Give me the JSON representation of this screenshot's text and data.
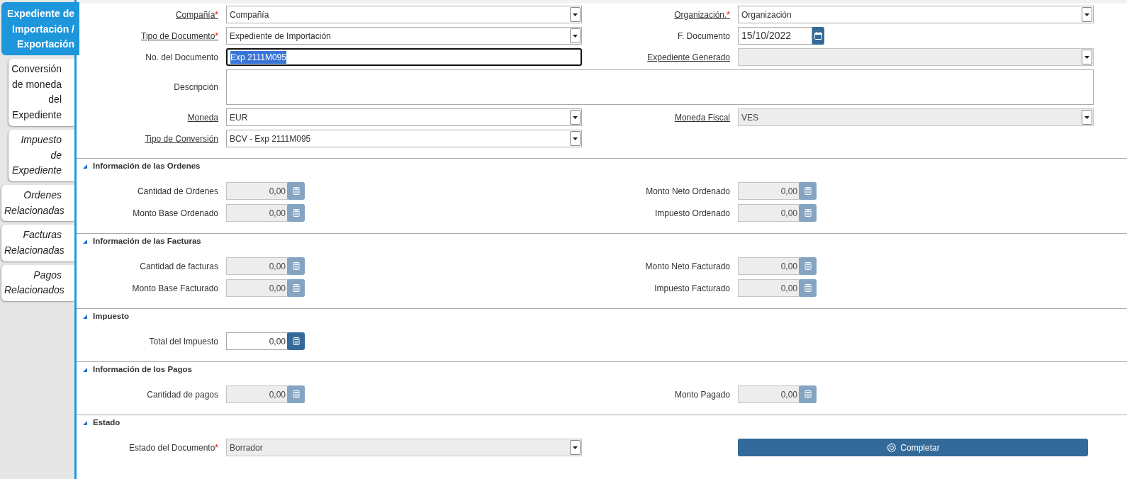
{
  "sidebar": {
    "tabs": [
      {
        "label": "Expediente de Importación / Exportación",
        "selected": true,
        "italic": false,
        "children": [
          {
            "label": "Conversión de moneda del Expediente",
            "selected": false,
            "italic": false
          },
          {
            "label": "Impuesto de Expediente",
            "selected": false,
            "italic": true
          }
        ]
      },
      {
        "label": "Ordenes Relacionadas",
        "selected": false,
        "italic": true
      },
      {
        "label": "Facturas Relacionadas",
        "selected": false,
        "italic": true
      },
      {
        "label": "Pagos Relacionados",
        "selected": false,
        "italic": true
      }
    ]
  },
  "header": {
    "rows": [
      [
        {
          "kind": "select",
          "label": "Compañía",
          "required_mark": "*",
          "link": true,
          "read_only": false,
          "value": "Compañía"
        },
        {
          "kind": "select",
          "label": "Organización.",
          "required_mark": "*",
          "link": true,
          "read_only": false,
          "value": "Organización"
        }
      ],
      [
        {
          "kind": "select",
          "label": "Tipo de Documento",
          "required_mark": "*",
          "link": true,
          "read_only": false,
          "value": "Expediente de Importación"
        },
        {
          "kind": "date",
          "label": "F. Documento",
          "link": false,
          "read_only": false,
          "value": "15/10/2022"
        }
      ],
      [
        {
          "kind": "text",
          "label": "No. del Documento",
          "link": false,
          "read_only": false,
          "focused": true,
          "value": "Exp 2111M095"
        },
        {
          "kind": "select",
          "label": "Expediente Generado",
          "link": true,
          "read_only": true
        }
      ],
      [
        {
          "kind": "textarea",
          "label": "Descripción",
          "link": false,
          "read_only": false
        }
      ],
      [
        {
          "kind": "select",
          "label": "Moneda",
          "link": true,
          "read_only": false,
          "value": "EUR"
        },
        {
          "kind": "select",
          "label": "Moneda Fiscal",
          "link": true,
          "read_only": true,
          "value": "VES"
        }
      ],
      [
        {
          "kind": "select",
          "label": "Tipo de Conversión",
          "link": true,
          "read_only": false,
          "value": "BCV - Exp 2111M095"
        }
      ]
    ]
  },
  "sections": [
    {
      "title": "Información de las Ordenes",
      "expanded": true,
      "rows": [
        [
          {
            "kind": "number",
            "label": "Cantidad de Ordenes",
            "read_only": true,
            "value": "0,00"
          },
          {
            "kind": "number",
            "label": "Monto Neto Ordenado",
            "read_only": true,
            "value": "0,00"
          }
        ],
        [
          {
            "kind": "number",
            "label": "Monto Base Ordenado",
            "read_only": true,
            "value": "0,00"
          },
          {
            "kind": "number",
            "label": "Impuesto Ordenado",
            "read_only": true,
            "value": "0,00"
          }
        ]
      ]
    },
    {
      "title": "Información de las Facturas",
      "expanded": true,
      "rows": [
        [
          {
            "kind": "number",
            "label": "Cantidad de facturas",
            "read_only": true,
            "value": "0,00"
          },
          {
            "kind": "number",
            "label": "Monto Neto Facturado",
            "read_only": true,
            "value": "0,00"
          }
        ],
        [
          {
            "kind": "number",
            "label": "Monto Base Facturado",
            "read_only": true,
            "value": "0,00"
          },
          {
            "kind": "number",
            "label": "Impuesto Facturado",
            "read_only": true,
            "value": "0,00"
          }
        ]
      ]
    },
    {
      "title": "Impuesto",
      "expanded": true,
      "rows": [
        [
          {
            "kind": "number",
            "label": "Total del Impuesto",
            "read_only": false,
            "value": "0,00"
          }
        ]
      ]
    },
    {
      "title": "Información de los Pagos",
      "expanded": true,
      "rows": [
        [
          {
            "kind": "number",
            "label": "Cantidad de pagos",
            "read_only": true,
            "value": "0,00"
          },
          {
            "kind": "number",
            "label": "Monto Pagado",
            "read_only": true,
            "value": "0,00"
          }
        ]
      ]
    },
    {
      "title": "Estado",
      "expanded": true,
      "rows": [
        [
          {
            "kind": "select",
            "label": "Estado del Documento",
            "required_mark": "*",
            "link": false,
            "read_only": true,
            "value": "Borrador"
          },
          {
            "kind": "button",
            "label": "Completar"
          }
        ]
      ]
    }
  ]
}
